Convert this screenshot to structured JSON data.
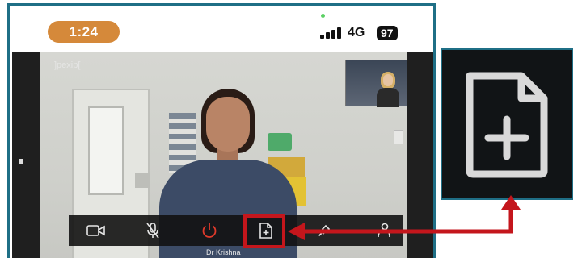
{
  "status_bar": {
    "time": "1:24",
    "network": "4G",
    "battery": "97"
  },
  "call": {
    "watermark": "]pexip[",
    "caller_name": "Dr Krishna"
  },
  "toolbar": {
    "buttons": [
      {
        "name": "camera",
        "icon": "video-camera-icon"
      },
      {
        "name": "mute",
        "icon": "microphone-muted-icon"
      },
      {
        "name": "end-call",
        "icon": "power-icon"
      },
      {
        "name": "share-file",
        "icon": "file-add-icon"
      },
      {
        "name": "pin",
        "icon": "pin-icon"
      },
      {
        "name": "participants",
        "icon": "person-icon"
      }
    ]
  },
  "colors": {
    "frame": "#1f6f86",
    "time_pill": "#d5893a",
    "highlight": "#c4161c",
    "end_call": "#e03a2b"
  }
}
